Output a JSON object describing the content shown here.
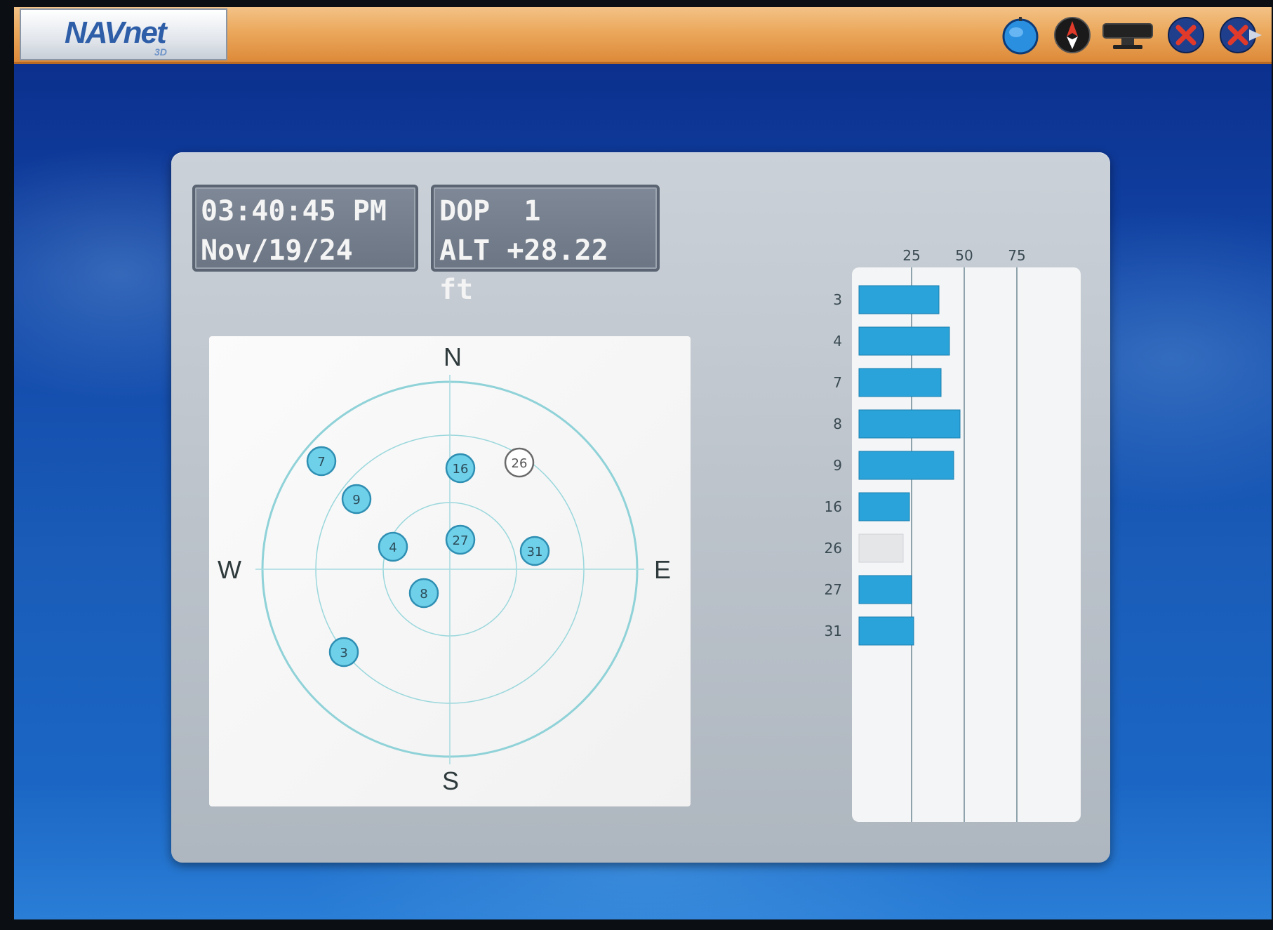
{
  "header": {
    "logo_main": "NAVnet",
    "logo_sub": "3D",
    "icons": [
      "globe-icon",
      "compass-icon",
      "display-icon",
      "close-red-icon",
      "back-icon"
    ]
  },
  "info": {
    "time": "03:40:45 PM",
    "date": "Nov/19/24",
    "dop": "DOP  1",
    "altitude": "ALT +28.22 ft"
  },
  "skyplot": {
    "north": "N",
    "south": "S",
    "east": "E",
    "west": "W",
    "satellites": [
      {
        "id": "7",
        "state": "active"
      },
      {
        "id": "9",
        "state": "active"
      },
      {
        "id": "16",
        "state": "active"
      },
      {
        "id": "26",
        "state": "inactive"
      },
      {
        "id": "4",
        "state": "active"
      },
      {
        "id": "27",
        "state": "active"
      },
      {
        "id": "31",
        "state": "active"
      },
      {
        "id": "8",
        "state": "active"
      },
      {
        "id": "3",
        "state": "active"
      }
    ]
  },
  "chart_data": {
    "type": "bar",
    "orientation": "horizontal",
    "categories": [
      "3",
      "4",
      "7",
      "8",
      "9",
      "16",
      "26",
      "27",
      "31"
    ],
    "values": [
      38,
      43,
      39,
      48,
      45,
      24,
      21,
      25,
      26
    ],
    "states": [
      "active",
      "active",
      "active",
      "active",
      "active",
      "active",
      "inactive",
      "active",
      "active"
    ],
    "xticks": [
      "25",
      "50",
      "75"
    ],
    "xlim": [
      0,
      100
    ],
    "colors": {
      "active": "#29a3d9",
      "inactive": "#e4e6e8"
    }
  }
}
